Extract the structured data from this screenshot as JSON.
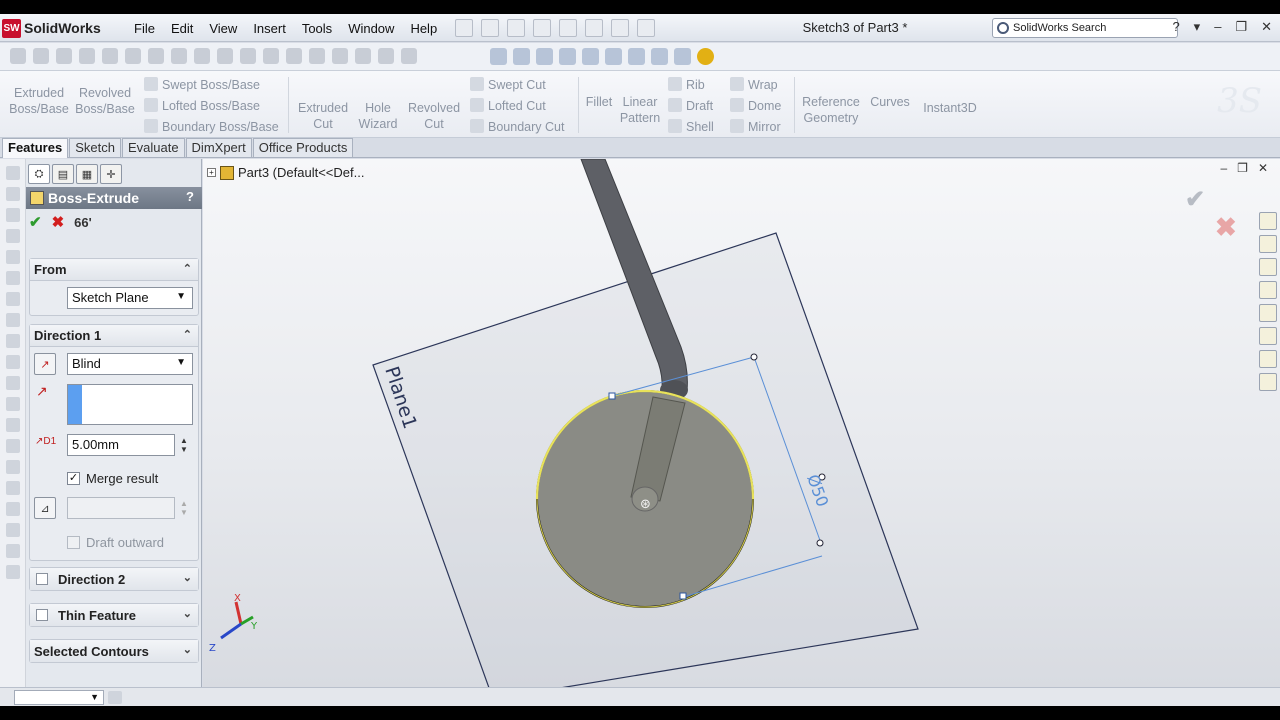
{
  "app": {
    "logo_text": "SolidWorks",
    "logo_mark": "SW",
    "document_title": "Sketch3 of Part3 *"
  },
  "menu": [
    "File",
    "Edit",
    "View",
    "Insert",
    "Tools",
    "Window",
    "Help"
  ],
  "search": {
    "placeholder": "SolidWorks Search"
  },
  "title_controls": [
    "?",
    "▾",
    "–",
    "❐",
    "✕"
  ],
  "ribbon": {
    "extruded_boss": "Extruded Boss/Base",
    "revolved_boss": "Revolved Boss/Base",
    "swept_boss": "Swept Boss/Base",
    "lofted_boss": "Lofted Boss/Base",
    "boundary_boss": "Boundary Boss/Base",
    "extruded_cut": "Extruded Cut",
    "hole_wizard": "Hole Wizard",
    "revolved_cut": "Revolved Cut",
    "swept_cut": "Swept Cut",
    "lofted_cut": "Lofted Cut",
    "boundary_cut": "Boundary Cut",
    "fillet": "Fillet",
    "linear_pattern": "Linear Pattern",
    "rib": "Rib",
    "draft": "Draft",
    "shell": "Shell",
    "wrap": "Wrap",
    "dome": "Dome",
    "mirror": "Mirror",
    "reference_geometry": "Reference Geometry",
    "curves": "Curves",
    "instant3d": "Instant3D"
  },
  "tabs": [
    "Features",
    "Sketch",
    "Evaluate",
    "DimXpert",
    "Office Products"
  ],
  "property_manager": {
    "title": "Boss-Extrude",
    "help": "?",
    "ok_glyph": "✔",
    "cancel_glyph": "✖",
    "from": {
      "label": "From",
      "value": "Sketch Plane"
    },
    "direction1": {
      "label": "Direction 1",
      "end_condition": "Blind",
      "depth": "5.00mm",
      "merge_result": "Merge result",
      "draft_outward": "Draft outward"
    },
    "direction2": {
      "label": "Direction 2"
    },
    "thin_feature": {
      "label": "Thin Feature"
    },
    "selected_contours": {
      "label": "Selected Contours"
    }
  },
  "graphics": {
    "tree_item": "Part3  (Default<<Def...",
    "plane_label": "Plane1",
    "dimension": "Ø50",
    "axis_x": "X",
    "axis_y": "Y",
    "axis_z": "Z",
    "window_controls": [
      "–",
      "❐",
      "✕"
    ]
  },
  "colors": {
    "accent": "#5c9ff0",
    "ok": "#2e9b2e",
    "cancel": "#d21e1e",
    "header": "#7b8493"
  }
}
